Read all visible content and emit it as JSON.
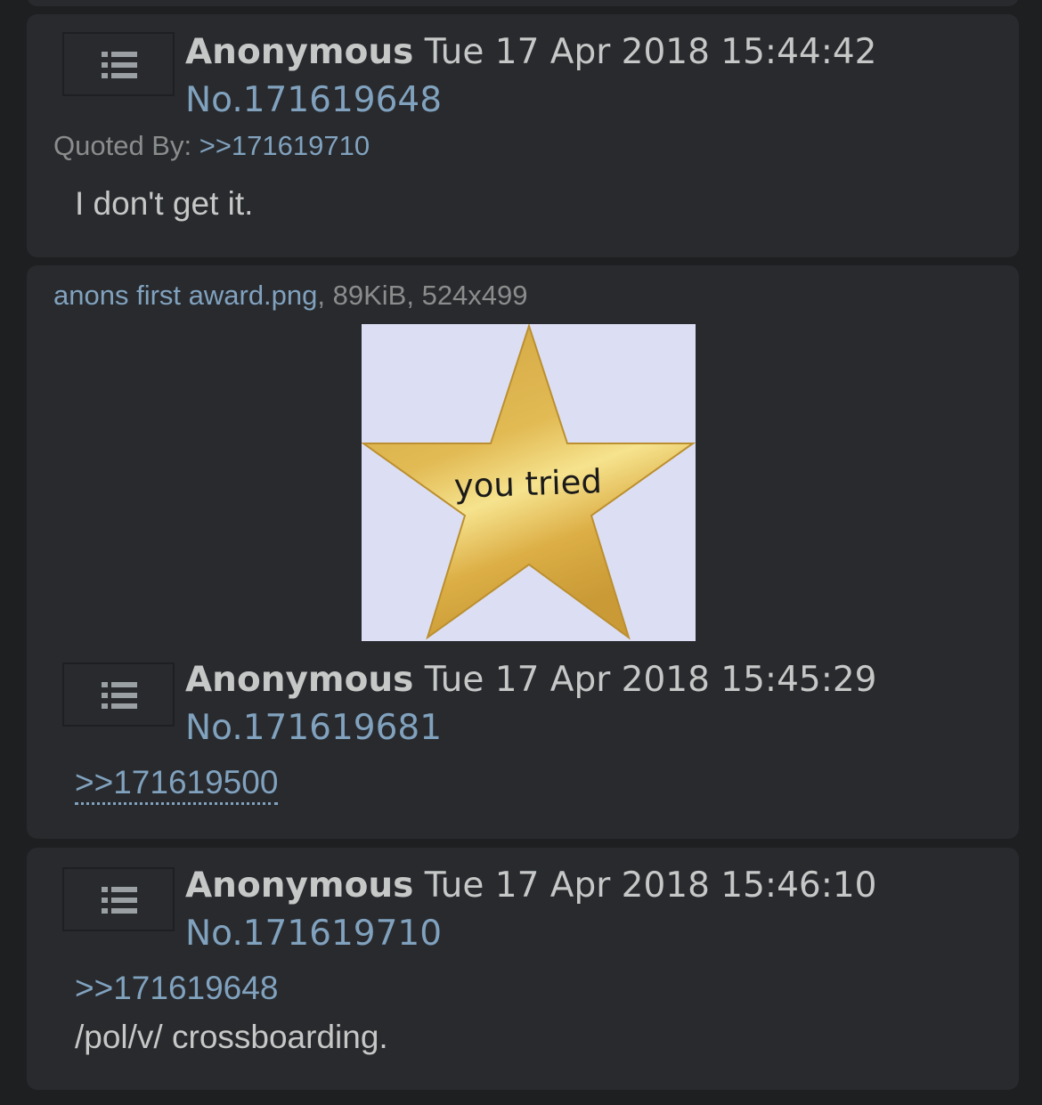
{
  "posts": [
    {
      "name": "Anonymous",
      "date": "Tue 17 Apr 2018 15:44:42",
      "number": "No.171619648",
      "quoted_by_label": "Quoted By:",
      "quoted_by_link": ">>171619710",
      "message": "I don't get it."
    },
    {
      "file_name": "anons first award.png",
      "file_meta": ", 89KiB, 524x499",
      "image_caption": "you tried",
      "name": "Anonymous",
      "date": "Tue 17 Apr 2018 15:45:29",
      "number": "No.171619681",
      "quote_link": ">>171619500"
    },
    {
      "name": "Anonymous",
      "date": "Tue 17 Apr 2018 15:46:10",
      "number": "No.171619710",
      "quote_link": ">>171619648",
      "message": "/pol/v/ crossboarding."
    }
  ],
  "icons": {
    "post_menu": "list-icon"
  },
  "colors": {
    "background": "#1d1f21",
    "post_bg": "#282a2e",
    "link": "#81a2be",
    "text": "#c5c8c6",
    "star": "#e2b84a"
  }
}
